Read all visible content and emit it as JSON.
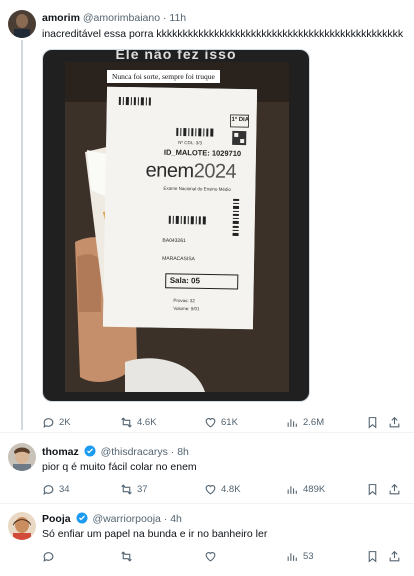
{
  "tweets": [
    {
      "name": "amorim",
      "handle": "@amorimbaiano",
      "time": "11h",
      "text": "inacreditável essa porra kkkkkkkkkkkkkkkkkkkkkkkkkkkkkkkkkkkkkkkkkkkkkkk",
      "replies": "2K",
      "retweets": "4.6K",
      "likes": "61K",
      "views": "2.6M"
    },
    {
      "name": "thomaz",
      "handle": "@thisdracarys",
      "time": "8h",
      "text": "pior q é muito fácil colar no enem",
      "replies": "34",
      "retweets": "37",
      "likes": "4.8K",
      "views": "489K"
    },
    {
      "name": "Pooja",
      "handle": "@warriorpooja",
      "time": "4h",
      "text": "Só enfiar um papel na bunda e ir no banheiro ler",
      "replies": "",
      "retweets": "",
      "likes": "",
      "views": "53"
    }
  ],
  "media": {
    "top_caption": "Ele não fez isso",
    "overlay_caption": "Nunca foi sorte, sempre foi truque",
    "day_label": "1º DIA",
    "malote": "ID_MALOTE: 1029710",
    "brand": "enem",
    "year": "2024",
    "brand_sub": "Exame Nacional do Ensino Médio",
    "code": "BA043261",
    "city": "MARACASISA",
    "sala": "Sala: 05",
    "provas": "Provas: 32",
    "volume": "Volume: 9/01",
    "cdl": "Nº CDL: 3/3",
    "colors": {
      "paper": "#f4f3ef",
      "orange": "#e8a040"
    }
  },
  "colors": {
    "accent": "#1d9bf0",
    "muted": "#536471",
    "border": "#eff3f4"
  }
}
